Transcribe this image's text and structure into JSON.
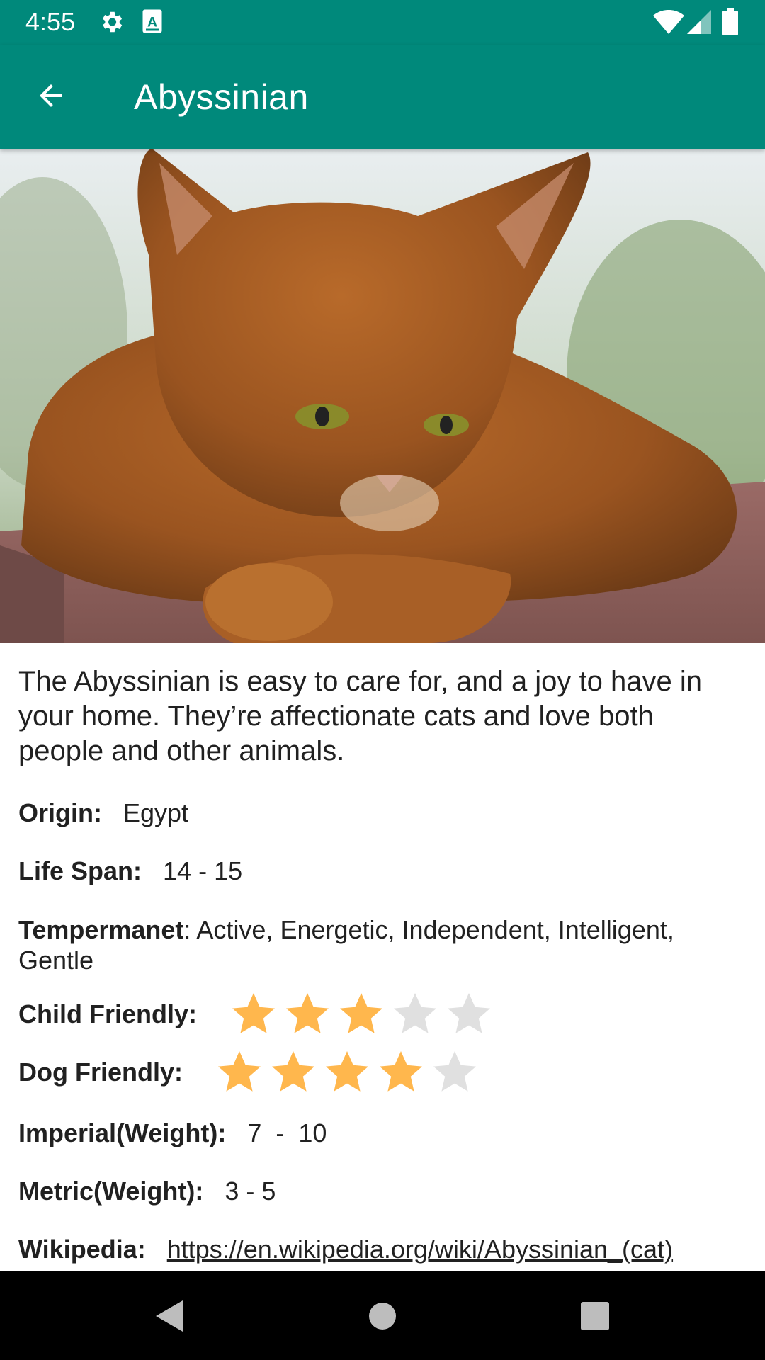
{
  "status_bar": {
    "time": "4:55",
    "icons": [
      "gear-icon",
      "a-icon",
      "wifi-icon",
      "signal-icon",
      "battery-icon"
    ]
  },
  "app_bar": {
    "title": "Abyssinian",
    "back_icon": "arrow-back-icon",
    "color": "#00897B"
  },
  "breed": {
    "description": "The Abyssinian is easy to care for, and a joy to have in your home. They’re affectionate cats and love both people and other animals.",
    "origin_label": "Origin:",
    "origin": "Egypt",
    "life_span_label": "Life Span:",
    "life_span": "14 - 15",
    "temperament_label": "Tempermanet",
    "temperament": ": Active, Energetic, Independent, Intelligent, Gentle",
    "child_friendly_label": "Child Friendly:",
    "child_friendly": 3,
    "dog_friendly_label": "Dog Friendly:",
    "dog_friendly": 4,
    "rating_max": 5,
    "imperial_label": "Imperial(Weight):",
    "imperial": "7  -  10",
    "metric_label": "Metric(Weight):",
    "metric": "3 - 5",
    "wikipedia_label": "Wikipedia:",
    "wikipedia": "https://en.wikipedia.org/wiki/Abyssinian_(cat)"
  },
  "colors": {
    "star_filled": "#FFB74D",
    "star_empty": "#E0E0E0"
  },
  "nav_bar": {
    "icons": [
      "back-triangle-icon",
      "home-circle-icon",
      "recents-square-icon"
    ]
  }
}
